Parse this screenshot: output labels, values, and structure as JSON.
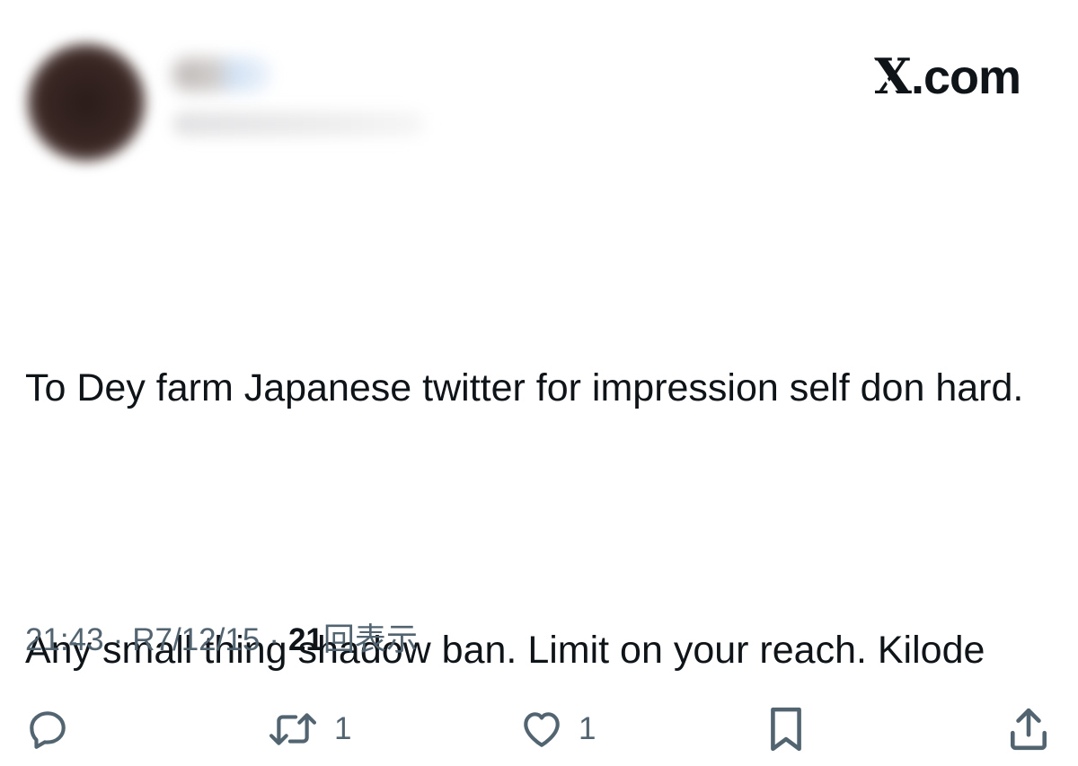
{
  "brand": {
    "label": ".com",
    "icon": "x-logo-icon"
  },
  "tweet": {
    "paragraphs": [
      "To Dey farm Japanese twitter for impression self don hard.",
      "Any small thing shadow ban. Limit on your reach. Kilode"
    ]
  },
  "meta": {
    "time": "21:43",
    "date": "R7/12/15",
    "separator": "·",
    "views_count": "21",
    "views_label": "回表示"
  },
  "actions": {
    "reply": {
      "icon": "reply-icon",
      "count": ""
    },
    "retweet": {
      "icon": "retweet-icon",
      "count": "1"
    },
    "like": {
      "icon": "heart-icon",
      "count": "1"
    },
    "bookmark": {
      "icon": "bookmark-icon",
      "count": ""
    },
    "share": {
      "icon": "share-icon",
      "count": ""
    }
  },
  "colors": {
    "text": "#0f1419",
    "muted": "#536471",
    "background": "#ffffff"
  }
}
